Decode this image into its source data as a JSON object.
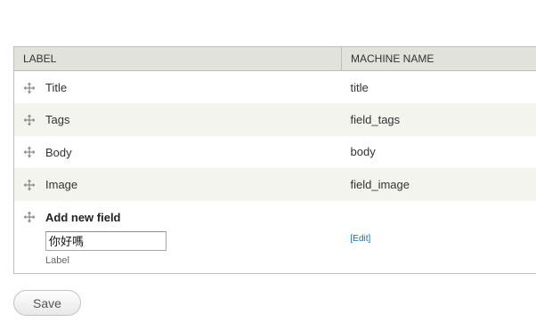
{
  "table": {
    "headers": {
      "label": "Label",
      "machine_name": "Machine name"
    },
    "rows": [
      {
        "label": "Title",
        "machine_name": "title"
      },
      {
        "label": "Tags",
        "machine_name": "field_tags"
      },
      {
        "label": "Body",
        "machine_name": "body"
      },
      {
        "label": "Image",
        "machine_name": "field_image"
      }
    ],
    "new_field": {
      "title": "Add new field",
      "input_value": "你好嗎",
      "input_description": "Label",
      "edit_bracket_open": "[",
      "edit_link": "Edit",
      "edit_bracket_close": "]"
    }
  },
  "actions": {
    "save_label": "Save"
  },
  "icons": {
    "drag_handle": "move-cross-icon"
  }
}
